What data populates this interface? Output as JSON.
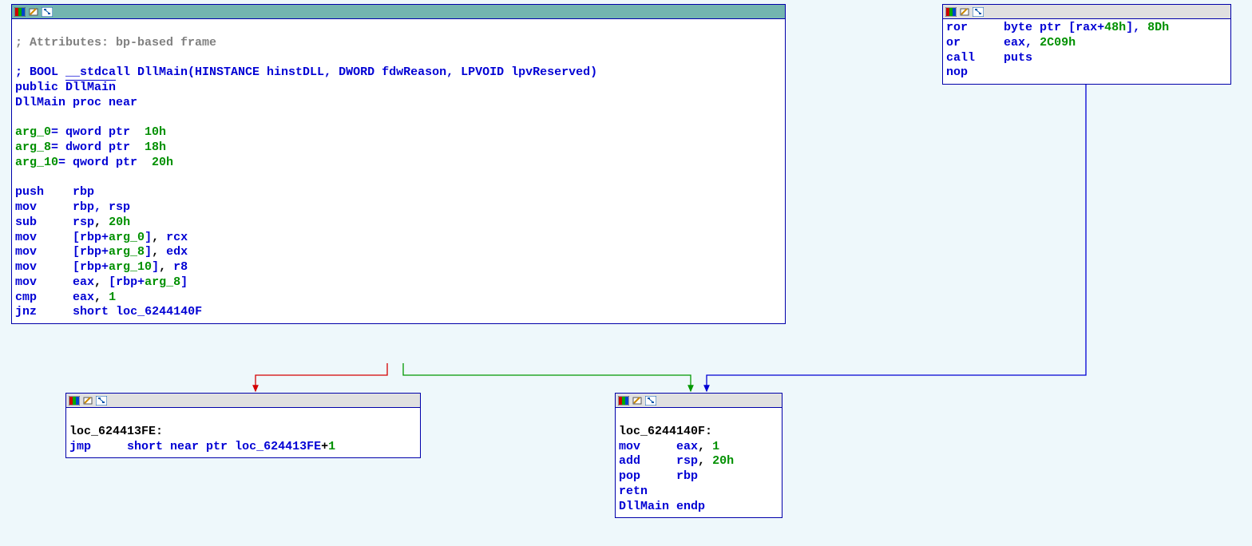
{
  "nodes": {
    "main": {
      "selected": true,
      "comment_attr": "; Attributes: bp-based frame",
      "comment_sig": "; BOOL __stdcall DllMain(HINSTANCE hinstDLL, DWORD fdwReason, LPVOID lpvReserved)",
      "public": "public",
      "public_sym": "DllMain",
      "proc_sym": "DllMain",
      "proc_kw": "proc near",
      "args": [
        {
          "name": "arg_0",
          "eq": "= qword ptr  ",
          "off": "10h"
        },
        {
          "name": "arg_8",
          "eq": "= dword ptr  ",
          "off": "18h"
        },
        {
          "name": "arg_10",
          "eq": "= qword ptr  ",
          "off": "20h"
        }
      ],
      "ins": {
        "push": "push",
        "mov": "mov",
        "sub": "sub",
        "cmp": "cmp",
        "jnz": "jnz",
        "rbp": "rbp",
        "rsp": "rsp",
        "rcx": "rcx",
        "edx": "edx",
        "r8": "r8",
        "eax": "eax",
        "n20h": "20h",
        "n1": "1",
        "a0": "arg_0",
        "a8": "arg_8",
        "a10": "arg_10",
        "short": "short",
        "loc": "loc_6244140F",
        "rbp_rsp": "rbp, rsp",
        "lb": "[rbp+",
        "rb": "]"
      }
    },
    "left": {
      "loc": "loc_624413FE",
      "colon": ":",
      "jmp": "jmp",
      "short": "short near ptr",
      "target": "loc_624413FE",
      "plus": "+",
      "one": "1"
    },
    "mid": {
      "loc": "loc_6244140F",
      "colon": ":",
      "mov": "mov",
      "eax": "eax",
      "one": "1",
      "add": "add",
      "rsp": "rsp",
      "n20h": "20h",
      "pop": "pop",
      "rbp": "rbp",
      "retn": "retn",
      "endp_sym": "DllMain",
      "endp": "endp"
    },
    "right": {
      "ror": "ror",
      "byte_ptr": "byte ptr",
      "lb": "[rax+",
      "off": "48h",
      "rb": "],",
      "imm1": "8Dh",
      "or": "or",
      "eax": "eax,",
      "imm2": "2C09h",
      "call": "call",
      "puts": "puts",
      "nop": "nop"
    }
  },
  "arrows": {
    "red": "#d40000",
    "green": "#009800",
    "blue": "#0000d4"
  }
}
